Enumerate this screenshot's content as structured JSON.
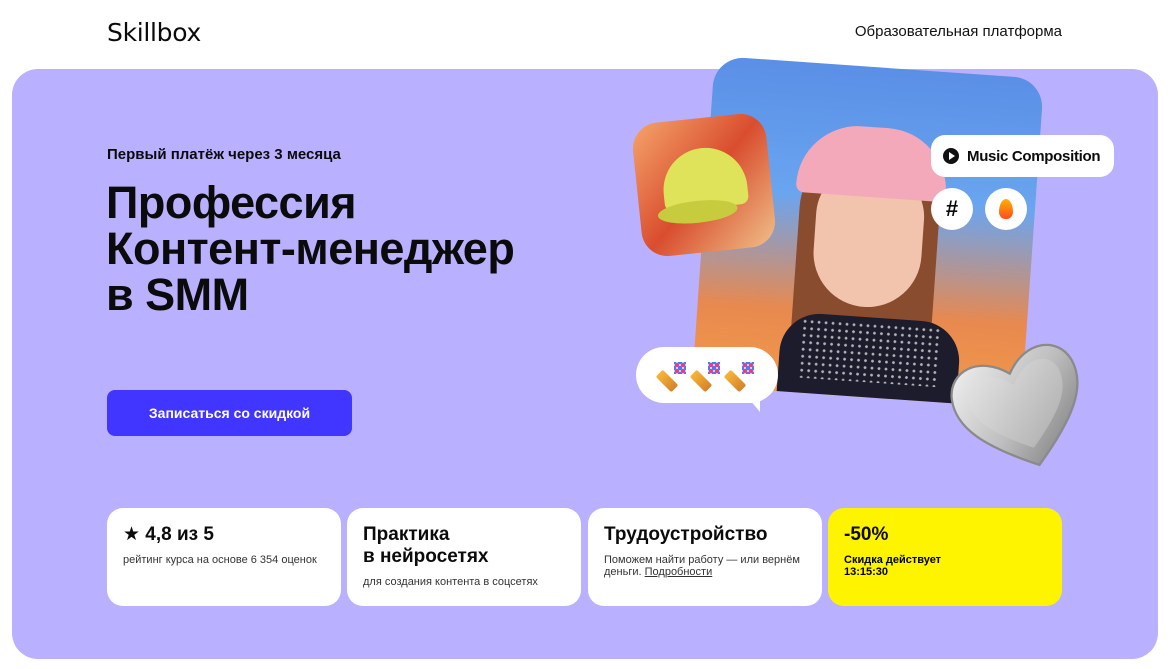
{
  "header": {
    "logo": "Skillbox",
    "platform_link": "Образовательная платформа"
  },
  "hero": {
    "subtitle": "Первый платёж через 3 месяца",
    "title_line1": "Профессия",
    "title_line2": "Контент-менеджер",
    "title_line3": "в SMM",
    "cta_label": "Записаться со скидкой",
    "music_chip": "Music Composition",
    "hash_chip": "#"
  },
  "cards": {
    "rating": {
      "title": "★ 4,8 из 5",
      "text": "рейтинг курса на основе 6 354 оценок"
    },
    "practice": {
      "title_line1": "Практика",
      "title_line2": "в нейросетях",
      "text": "для создания контента в соцсетях"
    },
    "employment": {
      "title": "Трудоустройство",
      "text": "Поможем найти работу — или вернём деньги.",
      "link": "Подробности"
    },
    "discount": {
      "title": "-50%",
      "text": "Скидка  действует",
      "timer": "13:15:30"
    }
  },
  "colors": {
    "hero_bg": "#b9b1ff",
    "cta_bg": "#4036ff",
    "discount_bg": "#fff400"
  },
  "icons": [
    "play-icon",
    "hash-icon",
    "fire-icon",
    "party-popper-icon",
    "heart-icon",
    "star-icon"
  ]
}
